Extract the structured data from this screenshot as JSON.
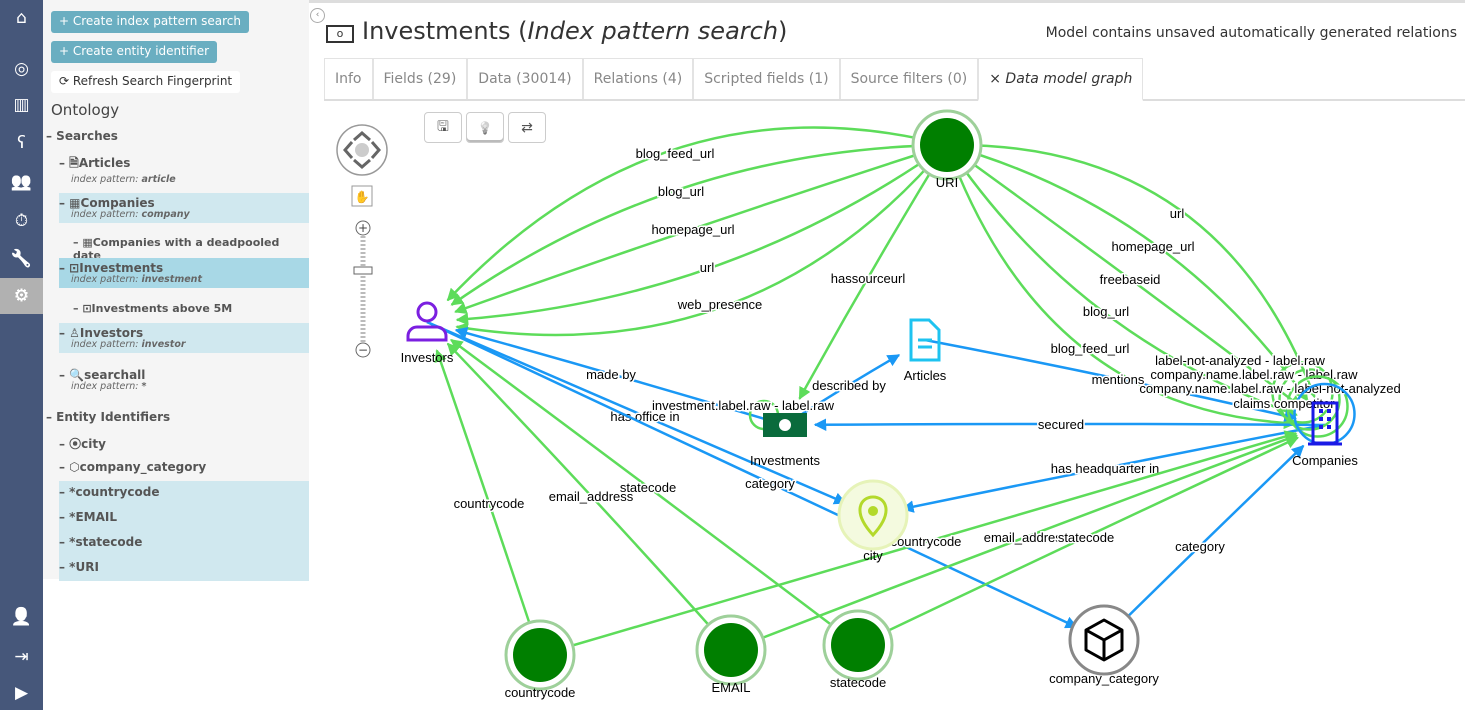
{
  "nav": {
    "items": [
      "home-icon",
      "compass-icon",
      "bar-chart-icon",
      "bear-icon",
      "users-icon",
      "alarm-icon",
      "wrench-icon",
      "gear-icon",
      "user-icon",
      "logout-icon",
      "play-icon"
    ],
    "active": "gear-icon"
  },
  "sidebar": {
    "create_search": "+ Create index pattern search",
    "create_entity": "+ Create entity identifier",
    "refresh": "⟳ Refresh Search Fingerprint",
    "ontology": "Ontology",
    "searches_label": "– Searches",
    "searches": [
      {
        "label": "– 🗎Articles",
        "pattern_label": "index pattern: ",
        "pattern": "article"
      },
      {
        "label": "– ▦Companies",
        "pattern_label": "index pattern: ",
        "pattern": "company"
      },
      {
        "label": "– ▦Companies with a deadpooled date"
      },
      {
        "label": "– ⊡Investments",
        "pattern_label": "index pattern: ",
        "pattern": "investment"
      },
      {
        "label": "– ⊡Investments above 5M"
      },
      {
        "label": "– ♙Investors",
        "pattern_label": "index pattern: ",
        "pattern": "investor"
      },
      {
        "label": "– 🔍searchall",
        "pattern_label": "index pattern: ",
        "pattern": "*"
      }
    ],
    "entities_label": "– Entity Identifiers",
    "entities": [
      "– ⦿city",
      "– ⬡company_category",
      "– *countrycode",
      "– *EMAIL",
      "– *statecode",
      "– *URI"
    ]
  },
  "header": {
    "title": "Investments (",
    "title_italic": "Index pattern search",
    "title_end": ")",
    "note": "Model contains unsaved automatically generated relations"
  },
  "tabs": [
    "Info",
    "Fields (29)",
    "Data (30014)",
    "Relations (4)",
    "Scripted fields (1)",
    "Source filters (0)",
    "⨯ Data model graph"
  ],
  "active_tab": "Data model graph",
  "toolbar": {
    "save": "🖫",
    "lightbulb": "💡",
    "swap": "⇄"
  },
  "graph": {
    "nodes": [
      {
        "id": "URI",
        "label": "URI",
        "kind": "eid"
      },
      {
        "id": "Investors",
        "label": "Investors",
        "kind": "search",
        "icon": "user-icon",
        "color": "#7b1fe0"
      },
      {
        "id": "Articles",
        "label": "Articles",
        "kind": "search",
        "icon": "document-icon",
        "color": "#1ec3f0"
      },
      {
        "id": "Investments",
        "label": "Investments",
        "kind": "search",
        "icon": "money-icon",
        "color": "#0a6b3c"
      },
      {
        "id": "Companies",
        "label": "Companies",
        "kind": "search",
        "icon": "building-icon",
        "color": "#1a1ae6"
      },
      {
        "id": "city",
        "label": "city",
        "kind": "city",
        "icon": "pin-icon",
        "color": "#b3d92b"
      },
      {
        "id": "countrycode",
        "label": "countrycode",
        "kind": "eid"
      },
      {
        "id": "EMAIL",
        "label": "EMAIL",
        "kind": "eid"
      },
      {
        "id": "statecode",
        "label": "statecode",
        "kind": "eid"
      },
      {
        "id": "company_category",
        "label": "company_category",
        "kind": "cube",
        "icon": "cube-icon"
      }
    ],
    "edges": [
      {
        "from": "URI",
        "to": "Investors",
        "label": "blog_feed_url",
        "type": "green"
      },
      {
        "from": "URI",
        "to": "Investors",
        "label": "blog_url",
        "type": "green"
      },
      {
        "from": "URI",
        "to": "Investors",
        "label": "homepage_url",
        "type": "green"
      },
      {
        "from": "URI",
        "to": "Investors",
        "label": "url",
        "type": "green"
      },
      {
        "from": "URI",
        "to": "Investors",
        "label": "web_presence",
        "type": "green"
      },
      {
        "from": "URI",
        "to": "Investments",
        "label": "hassourceurl",
        "type": "green"
      },
      {
        "from": "URI",
        "to": "Companies",
        "label": "url",
        "type": "green"
      },
      {
        "from": "URI",
        "to": "Companies",
        "label": "homepage_url",
        "type": "green"
      },
      {
        "from": "URI",
        "to": "Companies",
        "label": "freebaseid",
        "type": "green"
      },
      {
        "from": "URI",
        "to": "Companies",
        "label": "blog_url",
        "type": "green"
      },
      {
        "from": "URI",
        "to": "Companies",
        "label": "blog_feed_url",
        "type": "green"
      },
      {
        "from": "Investments",
        "to": "Investors",
        "label": "made by",
        "type": "blue"
      },
      {
        "from": "Investors",
        "to": "city",
        "label": "has office in",
        "type": "blue"
      },
      {
        "from": "Investors",
        "to": "company_category",
        "label": "category",
        "type": "blue"
      },
      {
        "from": "Investments",
        "to": "Articles",
        "label": "described by",
        "type": "blue"
      },
      {
        "from": "Articles",
        "to": "Companies",
        "label": "mentions",
        "type": "blue"
      },
      {
        "from": "Companies",
        "to": "Investments",
        "label": "secured",
        "type": "blue"
      },
      {
        "from": "Companies",
        "to": "city",
        "label": "has headquarter in",
        "type": "blue"
      },
      {
        "from": "company_category",
        "to": "Companies",
        "label": "category",
        "type": "blue"
      },
      {
        "from": "countrycode",
        "to": "Investors",
        "label": "countrycode",
        "type": "green"
      },
      {
        "from": "EMAIL",
        "to": "Investors",
        "label": "email_address",
        "type": "green"
      },
      {
        "from": "statecode",
        "to": "Investors",
        "label": "statecode",
        "type": "green"
      },
      {
        "from": "countrycode",
        "to": "Companies",
        "label": "countrycode",
        "type": "green"
      },
      {
        "from": "EMAIL",
        "to": "Companies",
        "label": "email_address",
        "type": "green"
      },
      {
        "from": "statecode",
        "to": "Companies",
        "label": "statecode",
        "type": "green"
      },
      {
        "from": "Investments",
        "to": "Investments",
        "label": "investment.label.raw - label.raw",
        "type": "green"
      },
      {
        "from": "Companies",
        "to": "Companies",
        "label": "label-not-analyzed - label.raw",
        "type": "green"
      },
      {
        "from": "Companies",
        "to": "Companies",
        "label": "company.name.label.raw - label.raw",
        "type": "green"
      },
      {
        "from": "Companies",
        "to": "Companies",
        "label": "company.name.label.raw - label-not-analyzed",
        "type": "green"
      },
      {
        "from": "Companies",
        "to": "Companies",
        "label": "claims competitor",
        "type": "blue"
      }
    ],
    "colors": {
      "green": "#5ddc5a",
      "blue": "#1a98f5",
      "eid": "#007f00"
    }
  }
}
